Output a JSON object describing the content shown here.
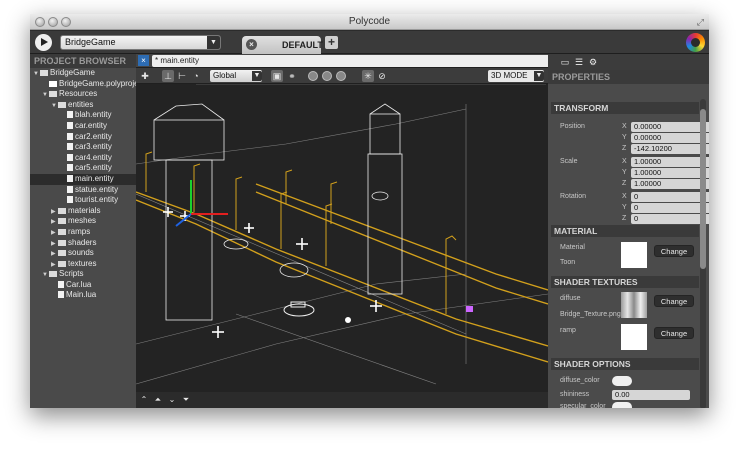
{
  "window": {
    "title": "Polycode"
  },
  "toolbar": {
    "project_selector": "BridgeGame",
    "tab_label": "DEFAULT",
    "tab_close": "×",
    "add_tab": "+"
  },
  "sidebar": {
    "header": "PROJECT BROWSER",
    "tree": [
      {
        "label": "BridgeGame",
        "depth": 0,
        "type": "folder",
        "expanded": true
      },
      {
        "label": "BridgeGame.polyproject",
        "depth": 1,
        "type": "project"
      },
      {
        "label": "Resources",
        "depth": 1,
        "type": "folder",
        "expanded": true
      },
      {
        "label": "entities",
        "depth": 2,
        "type": "folder",
        "expanded": true
      },
      {
        "label": "blah.entity",
        "depth": 3,
        "type": "file"
      },
      {
        "label": "car.entity",
        "depth": 3,
        "type": "file"
      },
      {
        "label": "car2.entity",
        "depth": 3,
        "type": "file"
      },
      {
        "label": "car3.entity",
        "depth": 3,
        "type": "file"
      },
      {
        "label": "car4.entity",
        "depth": 3,
        "type": "file"
      },
      {
        "label": "car5.entity",
        "depth": 3,
        "type": "file"
      },
      {
        "label": "main.entity",
        "depth": 3,
        "type": "file",
        "selected": true
      },
      {
        "label": "statue.entity",
        "depth": 3,
        "type": "file"
      },
      {
        "label": "tourist.entity",
        "depth": 3,
        "type": "file"
      },
      {
        "label": "materials",
        "depth": 2,
        "type": "folder",
        "expanded": false
      },
      {
        "label": "meshes",
        "depth": 2,
        "type": "folder",
        "expanded": false
      },
      {
        "label": "ramps",
        "depth": 2,
        "type": "folder",
        "expanded": false
      },
      {
        "label": "shaders",
        "depth": 2,
        "type": "folder",
        "expanded": false
      },
      {
        "label": "sounds",
        "depth": 2,
        "type": "folder",
        "expanded": false
      },
      {
        "label": "textures",
        "depth": 2,
        "type": "folder",
        "expanded": false
      },
      {
        "label": "Scripts",
        "depth": 1,
        "type": "folder",
        "expanded": true
      },
      {
        "label": "Car.lua",
        "depth": 2,
        "type": "file"
      },
      {
        "label": "Main.lua",
        "depth": 2,
        "type": "file"
      }
    ]
  },
  "editor": {
    "file_tab": "* main.entity",
    "file_close": "×",
    "transform_space": "Global",
    "view_mode": "3D MODE"
  },
  "properties": {
    "header": "PROPERTIES",
    "transform": {
      "title": "TRANSFORM",
      "position_label": "Position",
      "scale_label": "Scale",
      "rotation_label": "Rotation",
      "position": {
        "x": "0.00000",
        "y": "0.00000",
        "z": "-142.10200"
      },
      "scale": {
        "x": "1.00000",
        "y": "1.00000",
        "z": "1.00000"
      },
      "rotation": {
        "x": "0",
        "y": "0",
        "z": "0"
      },
      "axis_x": "X",
      "axis_y": "Y",
      "axis_z": "Z"
    },
    "material": {
      "title": "MATERIAL",
      "label": "Material",
      "value": "Toon",
      "change": "Change"
    },
    "shader_textures": {
      "title": "SHADER TEXTURES",
      "diffuse_label": "diffuse",
      "diffuse_file": "Bridge_Texture.png",
      "ramp_label": "ramp",
      "change": "Change"
    },
    "shader_options": {
      "title": "SHADER OPTIONS",
      "diffuse_color_label": "diffuse_color",
      "shininess_label": "shininess",
      "shininess_value": "0.00",
      "specular_color_label": "specular_color"
    }
  }
}
